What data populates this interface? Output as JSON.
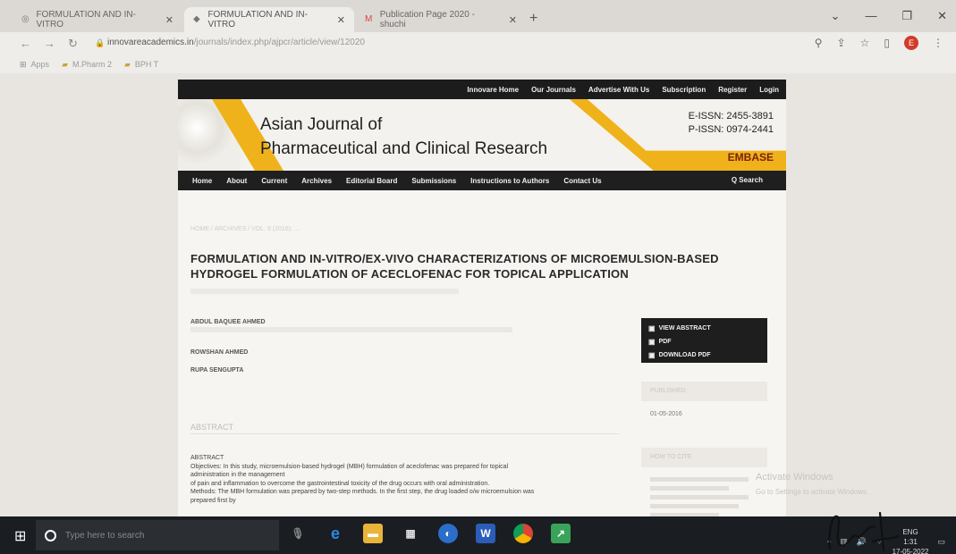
{
  "browser": {
    "tabs": [
      {
        "label": "FORMULATION AND IN-VITRO",
        "active": false
      },
      {
        "label": "FORMULATION AND IN-VITRO",
        "active": true
      },
      {
        "label": "Publication Page 2020 - shuchi",
        "active": false
      }
    ],
    "url_host": "innovareacademics.in",
    "url_path": "/journals/index.php/ajpcr/article/view/12020",
    "bookmarks": [
      "Apps",
      "M.Pharm 2",
      "BPH T"
    ],
    "avatar_letter": "E"
  },
  "journal": {
    "topnav": [
      "Innovare Home",
      "Our Journals",
      "Advertise With Us",
      "Subscription",
      "Register",
      "Login"
    ],
    "title_line1": "Asian Journal of",
    "title_line2": "Pharmaceutical and Clinical Research",
    "eissn": "E-ISSN: 2455-3891",
    "pissn": "P-ISSN: 0974-2441",
    "embase": "EMBASE",
    "mainnav": [
      "Home",
      "About",
      "Current",
      "Archives",
      "Editorial Board",
      "Submissions",
      "Instructions to Authors",
      "Contact Us"
    ],
    "search": "Q Search"
  },
  "article": {
    "breadcrumb": "HOME / ARCHIVES / VOL. 9 (2016): ...",
    "title": "FORMULATION AND IN-VITRO/EX-VIVO CHARACTERIZATIONS OF MICROEMULSION-BASED HYDROGEL FORMULATION OF ACECLOFENAC FOR TOPICAL APPLICATION",
    "authors": [
      "ABDUL BAQUEE AHMED",
      "ROWSHAN AHMED",
      "RUPA SENGUPTA"
    ],
    "actions": [
      "VIEW ABSTRACT",
      "PDF",
      "DOWNLOAD PDF"
    ],
    "published_label": "PUBLISHED",
    "published_date": "01-05-2016",
    "cite_label": "HOW TO CITE",
    "abstract_heading": "ABSTRACT",
    "abstract_lines": [
      "ABSTRACT",
      "Objectives: In this study, microemulsion-based hydrogel (MBH) formulation of aceclofenac was prepared for topical",
      "administration in the management",
      "of pain and inflammation to overcome the gastrointestinal toxicity of the drug occurs with oral administration.",
      "Methods: The MBH formulation was prepared by two-step methods. In the first step, the drug loaded o/w microemulsion was",
      "prepared first by"
    ]
  },
  "os": {
    "watermark_title": "Activate Windows",
    "watermark_sub": "Go to Settings to activate Windows.",
    "search_placeholder": "Type here to search",
    "lang": "ENG",
    "time": "1:31",
    "date": "17-05-2022"
  }
}
